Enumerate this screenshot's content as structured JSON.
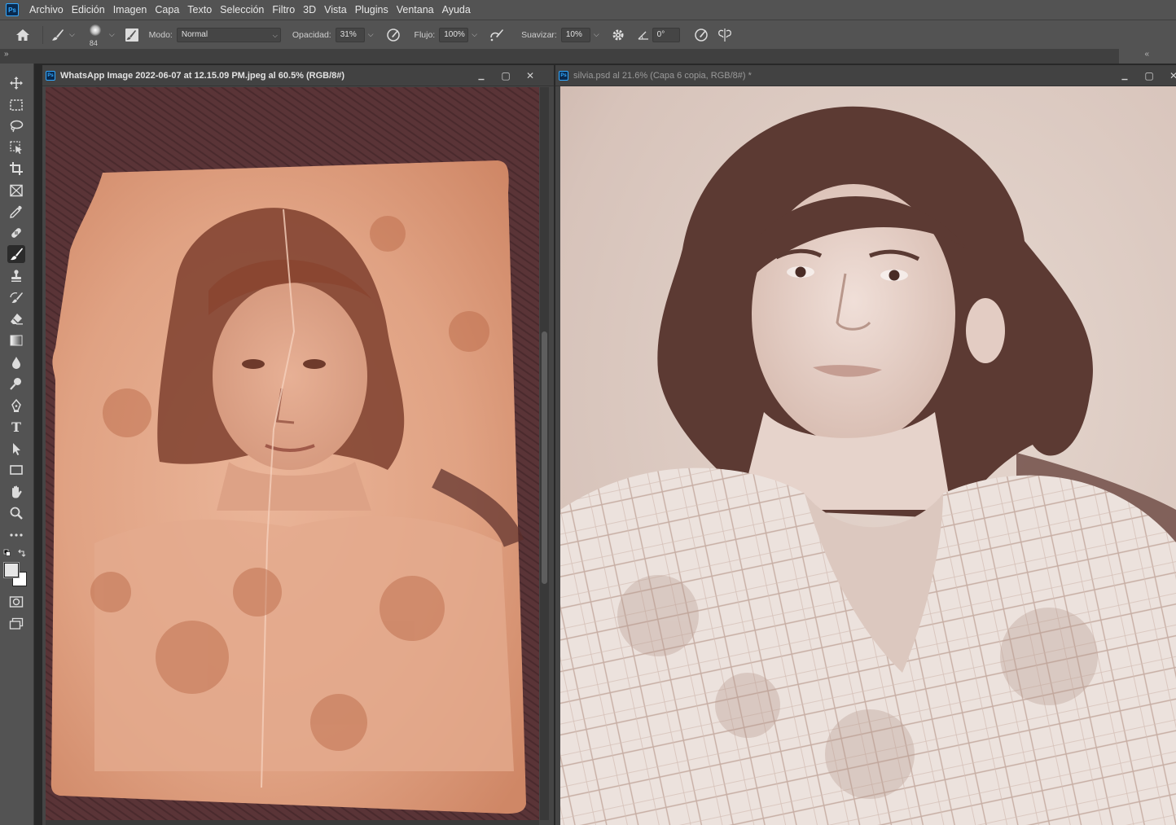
{
  "app": {
    "logo": "Ps"
  },
  "menu": [
    "Archivo",
    "Edición",
    "Imagen",
    "Capa",
    "Texto",
    "Selección",
    "Filtro",
    "3D",
    "Vista",
    "Plugins",
    "Ventana",
    "Ayuda"
  ],
  "options": {
    "brush_size": "84",
    "mode_label": "Modo:",
    "mode_value": "Normal",
    "opacity_label": "Opacidad:",
    "opacity_value": "31%",
    "flow_label": "Flujo:",
    "flow_value": "100%",
    "smooth_label": "Suavizar:",
    "smooth_value": "10%",
    "angle_value": "0°"
  },
  "panel_collapse": {
    "left": "»",
    "right": "«"
  },
  "documents": [
    {
      "title": "WhatsApp Image 2022-06-07 at 12.15.09 PM.jpeg al 60.5% (RGB/8#)",
      "active": true
    },
    {
      "title": "silvia.psd al 21.6% (Capa 6 copia, RGB/8#) *",
      "active": false
    }
  ],
  "tools": [
    "move-icon",
    "marquee-icon",
    "lasso-icon",
    "object-select-icon",
    "crop-icon",
    "frame-icon",
    "eyedropper-icon",
    "healing-icon",
    "brush-icon",
    "stamp-icon",
    "history-brush-icon",
    "eraser-icon",
    "gradient-icon",
    "blur-icon",
    "dodge-icon",
    "pen-icon",
    "type-icon",
    "path-select-icon",
    "rectangle-icon",
    "hand-icon",
    "zoom-icon",
    "more-icon",
    "swap-colors-icon",
    "color-swatches-icon",
    "quick-mask-icon",
    "screen-mode-icon"
  ],
  "type_tool_glyph": "T",
  "colors": {
    "foreground": "#e6e6e6",
    "background": "#ffffff",
    "accent": "#31a8ff"
  },
  "window_glyphs": {
    "minimize": "▁",
    "maximize": "▢",
    "close": "✕"
  }
}
